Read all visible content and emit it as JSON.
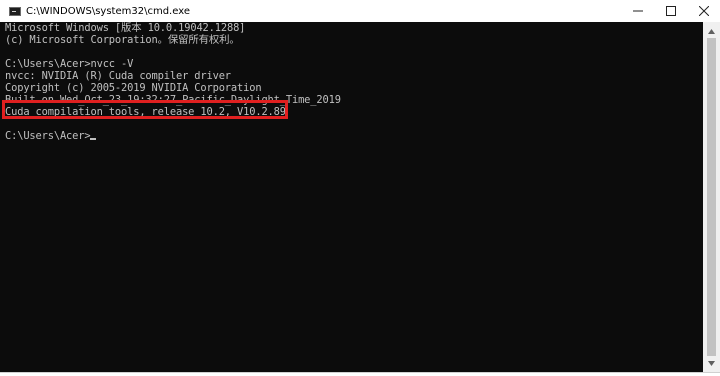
{
  "window": {
    "title": "C:\\WINDOWS\\system32\\cmd.exe",
    "icon": "console-app-icon",
    "controls": {
      "minimize_icon": "minimize-icon",
      "maximize_icon": "maximize-icon",
      "close_icon": "close-icon"
    }
  },
  "console": {
    "lines": [
      "Microsoft Windows [版本 10.0.19042.1288]",
      "(c) Microsoft Corporation。保留所有权利。",
      "",
      "C:\\Users\\Acer>nvcc -V",
      "nvcc: NVIDIA (R) Cuda compiler driver",
      "Copyright (c) 2005-2019 NVIDIA Corporation",
      "Built on Wed_Oct_23_19:32:27_Pacific_Daylight_Time_2019",
      "Cuda compilation tools, release 10.2, V10.2.89",
      "",
      "C:\\Users\\Acer>"
    ],
    "background_color": "#0c0c0c",
    "text_color": "#c0c0c0",
    "highlight_color": "#e02020"
  },
  "scrollbar": {
    "up_icon": "scroll-up-arrow-icon",
    "down_icon": "scroll-down-arrow-icon"
  }
}
